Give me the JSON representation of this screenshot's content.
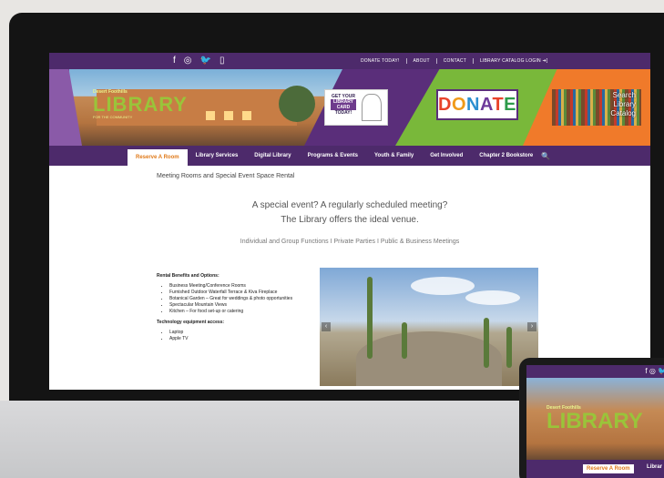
{
  "topbar": {
    "social": [
      "f",
      "◎",
      "🐦",
      "▯"
    ],
    "links": [
      "DONATE TODAY!",
      "ABOUT",
      "CONTACT",
      "LIBRARY CATALOG LOGIN ➜]"
    ]
  },
  "banner": {
    "logo_small": "Desert Foothills",
    "logo_big": "LIBRARY",
    "logo_tag": "FOR THE COMMUNITY",
    "card_lines": [
      "GET YOUR",
      "LIBRARY",
      "CARD",
      "TODAY!"
    ],
    "donate_letters": [
      "D",
      "O",
      "N",
      "A",
      "T",
      "E"
    ],
    "search_lines": [
      "Search",
      "Library",
      "Catalog"
    ]
  },
  "nav": {
    "items": [
      "Reserve A Room",
      "Library Services",
      "Digital Library",
      "Programs & Events",
      "Youth & Family",
      "Get Involved",
      "Chapter 2 Bookstore"
    ],
    "search_icon": "🔍"
  },
  "content": {
    "breadcrumb": "Meeting Rooms and Special Event Space Rental",
    "headline_1": "A special event? A regularly scheduled meeting?",
    "headline_2": "The Library offers the ideal venue.",
    "subline": "Individual and Group Functions  I  Private Parties  I  Public & Business Meetings",
    "rental_title": "Rental Benefits and Options:",
    "rental_items": [
      "Business Meeting/Conference Rooms",
      "Furnished Outdoor Waterfall Terrace & Kiva Fireplace",
      "Botanical Garden – Great for weddings & photo opportunities",
      "Spectacular Mountain Views",
      "Kitchen – For food set-up or catering"
    ],
    "tech_title": "Technology equipment access:",
    "tech_items": [
      "Laptop",
      "Apple TV"
    ]
  },
  "tablet": {
    "social": "f ◎ 🐦",
    "logo_small": "Desert Foothills",
    "logo_big": "LIBRARY",
    "nav_active": "Reserve A Room",
    "nav_next": "Librar"
  },
  "colors": {
    "purple": "#4d2a6b",
    "green": "#79b83a",
    "orange": "#f07a2a",
    "nav_active_text": "#e07a1a"
  }
}
